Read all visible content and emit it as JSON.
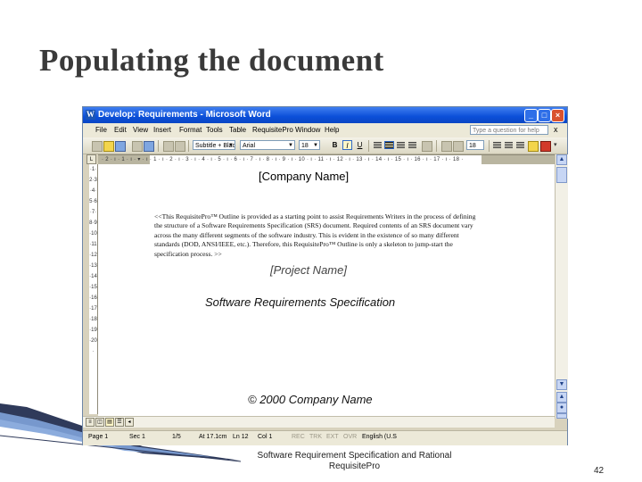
{
  "slide": {
    "title": "Populating the document",
    "footer": "Software Requirement Specification and Rational RequisitePro",
    "page_number": "42"
  },
  "window": {
    "title": "Develop: Requirements - Microsoft Word",
    "icon": "word-icon",
    "controls": [
      "minimize-icon",
      "maximize-icon",
      "close-icon"
    ]
  },
  "menubar": {
    "items": [
      "File",
      "Edit",
      "View",
      "Insert",
      "Format",
      "Tools",
      "Table",
      "RequisitePro",
      "Window",
      "Help"
    ],
    "help_placeholder": "Type a question for help",
    "close_glyph": "x"
  },
  "toolbar": {
    "style_value": "Subtitle + Blac",
    "font_value": "Arial",
    "size_value": "18",
    "zoom_value": "18",
    "bold_label": "B",
    "italic_label": "I",
    "underline_label": "U"
  },
  "ruler": {
    "text": "· 2 · ı · 1 · ı · ▾ · ı · 1 · ı · 2 · ı · 3 · ı · 4 · ı · 5 · ı · 6 · ı · 7 · ı · 8 · ı · 9 · ı · 10 · ı · 11 · ı · 12 · ı · 13 · ı · 14 · ı · 15 · ı · 16 · ı · 17 · ı · 18 ·",
    "vertical_text": "·1·2·3·4·5·6·7·8·9·10·11·12·13·14·15·16·17·18·19·20·"
  },
  "document": {
    "company_name": "[Company Name]",
    "intro_paragraph": "<<This RequisitePro™ Outline is provided as a starting point to assist Requirements Writers in the process of defining the structure of a Software Requirements Specification (SRS) document. Required contents of an SRS document vary across the many different segments of the software industry. This is evident in the existence of so many different standards (DOD, ANSI/IEEE, etc.). Therefore, this RequisitePro™ Outline is only a skeleton to jump-start the specification process. >>",
    "project_name": "[Project Name]",
    "doc_title": "Software Requirements Specification",
    "copyright": "© 2000 Company Name"
  },
  "statusbar": {
    "page": "Page 1",
    "section": "Sec 1",
    "page_of": "1/5",
    "at": "At 17.1cm",
    "line": "Ln 12",
    "col": "Col 1",
    "rec": "REC",
    "trk": "TRK",
    "ext": "EXT",
    "ovr": "OVR",
    "language": "English (U.S"
  }
}
